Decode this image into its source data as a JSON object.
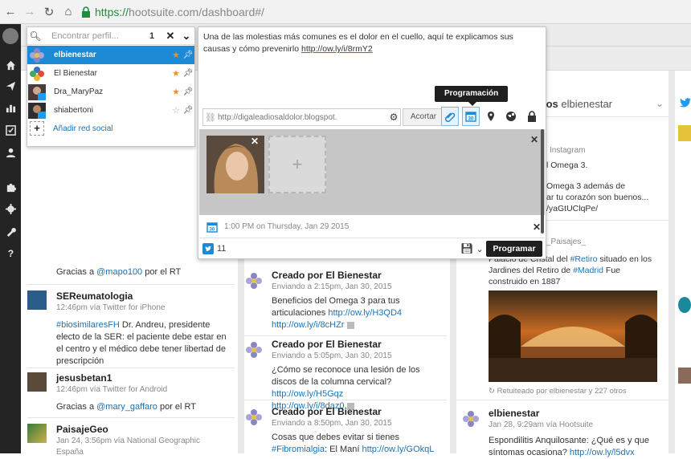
{
  "browser": {
    "url_scheme": "https://",
    "url_host_path": "hootsuite.com/dashboard#/"
  },
  "sidebar_icons": [
    "home-icon",
    "send-icon",
    "bar-chart-icon",
    "checkbox-icon",
    "user-icon",
    "puzzle-icon",
    "gear-icon",
    "wrench-icon",
    "help-icon"
  ],
  "profile_picker": {
    "placeholder": "Encontrar perfil...",
    "count": "1",
    "items": [
      {
        "label": "elbienestar",
        "starred": true,
        "selected": true
      },
      {
        "label": "El Bienestar",
        "starred": true,
        "selected": false
      },
      {
        "label": "Dra_MaryPaz",
        "starred": true,
        "selected": false
      },
      {
        "label": "shiabertoni",
        "starred": false,
        "selected": false
      }
    ],
    "add_label": "Añadir red social"
  },
  "composer": {
    "message_text": "Una de las molestias más comunes es el dolor en el cuello, aquí te explicamos sus causas y cómo prevenirlo ",
    "message_link": "http://ow.ly/i/8rmY2",
    "link_input": "http://digaleadiosaldolor.blogspot.",
    "shorten_label": "Acortar",
    "tooltip": "Programación",
    "schedule_text": "1:00 PM on Thursday, Jan 29 2015",
    "char_count": "11",
    "submit_label": "Programar"
  },
  "col1": {
    "top_text": "Gracias a ",
    "top_link": "@mapo100",
    "top_tail": " por el RT",
    "posts": [
      {
        "name": "SEReumatologia",
        "meta": "12:46pm vía Twitter for iPhone",
        "tag": "#biosimilaresFH",
        "text": " Dr. Andreu, presidente electo de la SER: el paciente debe estar en el centro y el médico debe tener libertad de prescripción"
      },
      {
        "name": "jesusbetan1",
        "meta": "12:46pm vía Twitter for Android",
        "text_pre": "Gracias a ",
        "link": "@mary_gaffaro",
        "text_post": " por el RT"
      },
      {
        "name": "PaisajeGeo",
        "meta": "Jan 24, 3:56pm vía National Geographic",
        "text": "España"
      }
    ]
  },
  "col2": {
    "posts": [
      {
        "name": "Creado por El Bienestar",
        "meta": "Enviando a 2:15pm, Jan 30, 2015",
        "text": "Beneficios del Omega 3 para tus articulaciones ",
        "link1": "http://ow.ly/H3QD4",
        "link2": "http://ow.ly/i/8cHZr"
      },
      {
        "name": "Creado por El Bienestar",
        "meta": "Enviando a 5:05pm, Jan 30, 2015",
        "text": "¿Cómo se reconoce una lesión de los discos de la columna cervical? ",
        "link1": "http://ow.ly/H5Gqz",
        "link2": "http://ow.ly/i/8daz0"
      },
      {
        "name": "Creado por El Bienestar",
        "meta": "Enviando a 8:50pm, Jan 30, 2015",
        "text": "Cosas que debes evitar si tienes ",
        "tag": "#Fibromialgia",
        "text2": ": El Maní ",
        "link1": "http://ow.ly/GOkqL"
      }
    ]
  },
  "col3": {
    "header_bold": "los",
    "header_rest": " elbienestar",
    "snips": {
      "instagram": "Instagram",
      "omega": "l Omega 3.",
      "omega2": "Omega 3 además de",
      "corazon": "ar tu corazón son buenos...",
      "link": "/yaGtUClqPe/",
      "paisajes": "_Paisajes_",
      "palacio": "Palacio de Cristal del ",
      "retiro_tag": "#Retiro",
      "palacio2": " situado en los",
      "jardines": "Jardines del Retiro de ",
      "madrid_tag": "#Madrid",
      "fue": " Fue",
      "construido": "construido en 1887"
    },
    "retweet": "Retuiteado por elbienestar y 227 otros",
    "post": {
      "name": "elbienestar",
      "meta": "Jan 28, 9:29am vía Hootsuite",
      "text": "Espondilitis Anquilosante: ¿Qué es y que síntomas ocasiona? ",
      "link": "http://ow.ly/l5dvx"
    }
  },
  "colors": {
    "accent": "#1d8ad6",
    "sidebar": "#242424",
    "link": "#1a73b8",
    "star": "#f0901f"
  }
}
